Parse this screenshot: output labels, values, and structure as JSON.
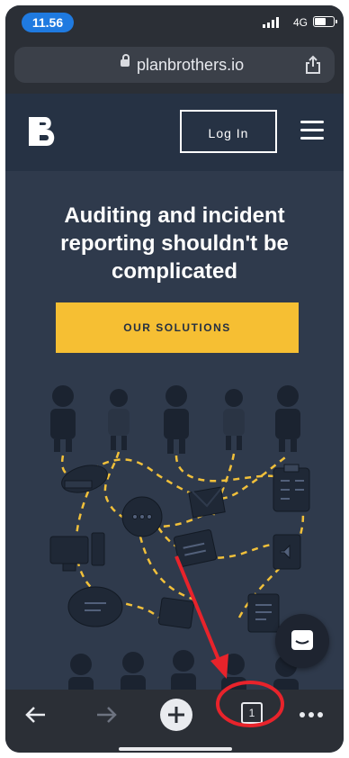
{
  "status_bar": {
    "time": "11.56",
    "network": "4G"
  },
  "browser": {
    "url": "planbrothers.io"
  },
  "site": {
    "login_label": "Log In",
    "hero_title": "Auditing and incident reporting shouldn't be complicated",
    "cta_label": "OUR SOLUTIONS"
  },
  "toolbar": {
    "tab_count": "1"
  },
  "colors": {
    "accent_yellow": "#f6bf33",
    "page_bg": "#2f3a4c",
    "header_bg": "#263244",
    "annotation_red": "#e8232b"
  }
}
